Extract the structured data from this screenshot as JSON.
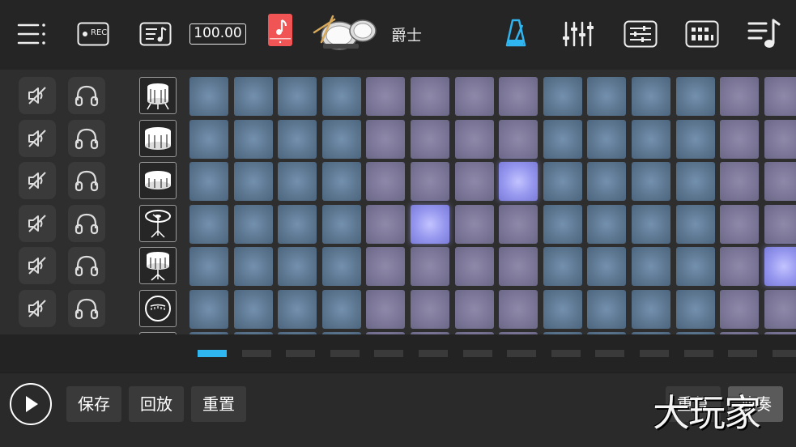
{
  "topbar": {
    "tempo": "100.00",
    "kit_name": "爵士",
    "rec_label": "REC",
    "icons": [
      "menu-icon",
      "record-icon",
      "song-icon",
      "tempo-display",
      "music-note-icon",
      "drum-kit-icon",
      "metronome-icon",
      "mixer-icon",
      "settings-sliders-icon",
      "grid-icon",
      "playlist-icon"
    ],
    "accent_color": "#2fb6f0",
    "note_button_color": "#f05454"
  },
  "tracks": [
    {
      "instrument": "bass-drum-icon",
      "active_steps": []
    },
    {
      "instrument": "snare-drum-icon",
      "active_steps": []
    },
    {
      "instrument": "tom-icon",
      "active_steps": [
        7
      ]
    },
    {
      "instrument": "cymbal-icon",
      "active_steps": [
        5
      ]
    },
    {
      "instrument": "floor-tom-icon",
      "active_steps": [
        13
      ]
    },
    {
      "instrument": "kick-front-icon",
      "active_steps": []
    }
  ],
  "steps": {
    "visible_count": 14,
    "group_colors": [
      "blue",
      "blue",
      "blue",
      "blue",
      "purple",
      "purple",
      "purple",
      "purple",
      "blue",
      "blue",
      "blue",
      "blue",
      "purple",
      "purple"
    ]
  },
  "pager": {
    "count": 14,
    "active_index": 0
  },
  "bottombar": {
    "save_label": "保存",
    "playback_label": "回放",
    "reset_label": "重置",
    "repeat_label": "重复",
    "solo_label": "独奏"
  },
  "watermark": "大玩家"
}
